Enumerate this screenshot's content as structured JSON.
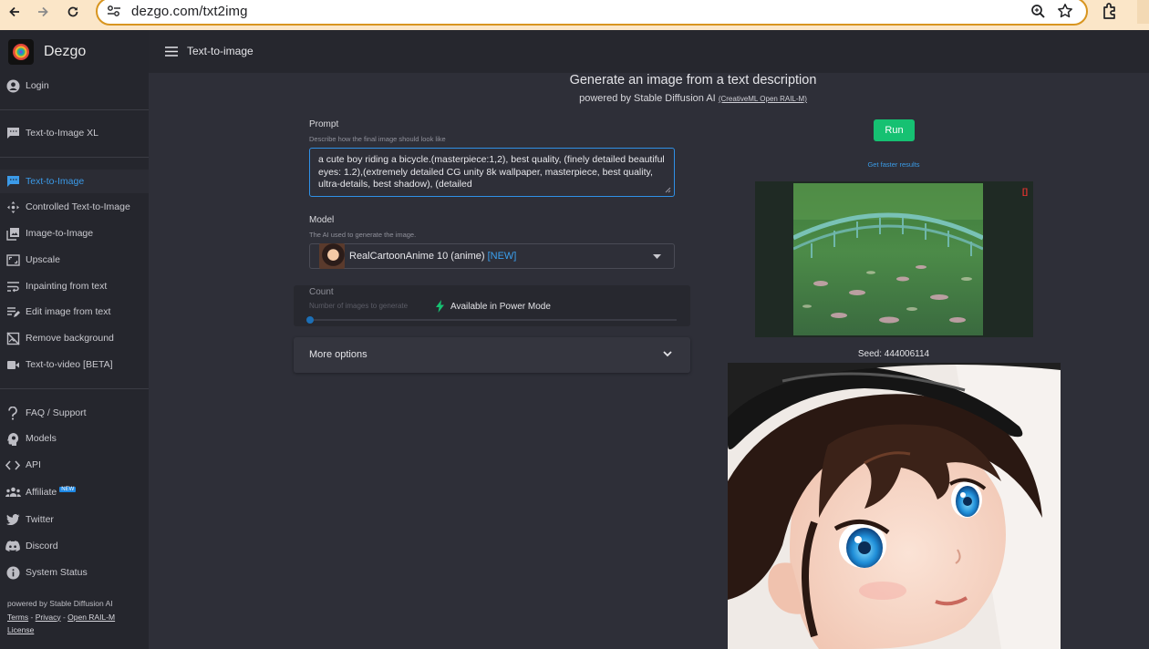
{
  "browser": {
    "url": "dezgo.com/txt2img"
  },
  "sidebar": {
    "brand": "Dezgo",
    "login": "Login",
    "items": [
      {
        "label": "Text-to-Image XL"
      },
      {
        "label": "Text-to-Image",
        "active": true
      },
      {
        "label": "Controlled Text-to-Image"
      },
      {
        "label": "Image-to-Image"
      },
      {
        "label": "Upscale"
      },
      {
        "label": "Inpainting from text"
      },
      {
        "label": "Edit image from text"
      },
      {
        "label": "Remove background"
      },
      {
        "label": "Text-to-video [BETA]"
      }
    ],
    "links": [
      {
        "label": "FAQ / Support"
      },
      {
        "label": "Models"
      },
      {
        "label": "API"
      },
      {
        "label": "Affiliate",
        "badge": "NEW"
      },
      {
        "label": "Twitter"
      },
      {
        "label": "Discord"
      },
      {
        "label": "System Status"
      }
    ],
    "footer": {
      "powered": "powered by Stable Diffusion AI",
      "terms": "Terms",
      "privacy": "Privacy",
      "rail": "Open RAIL-M",
      "license": "License",
      "sep": " - "
    }
  },
  "topbar": {
    "title": "Text-to-image"
  },
  "main": {
    "title": "Generate an image from a text description",
    "subtitle": "powered by Stable Diffusion AI",
    "license_link": "(CreativeML Open RAIL-M)",
    "prompt": {
      "label": "Prompt",
      "help": "Describe how the final image should look like",
      "value": "a cute boy riding a bicycle.(masterpiece:1,2), best quality, (finely detailed beautiful eyes: 1.2),(extremely detailed CG unity 8k wallpaper, masterpiece, best quality, ultra-details, best shadow), (detailed"
    },
    "model": {
      "label": "Model",
      "help": "The AI used to generate the image.",
      "selected": "RealCartoonAnime 10 (anime)",
      "selected_tag": "[NEW]"
    },
    "count": {
      "label": "Count",
      "help": "Number of images to generate",
      "power_mode": "Available in Power Mode"
    },
    "more_options": "More options"
  },
  "right": {
    "run_label": "Run",
    "faster_link": "Get faster results",
    "preview_corner": "[]",
    "seed_text": "Seed: 444006114"
  },
  "colors": {
    "accent_blue": "#2f90e6",
    "run_green": "#16c172",
    "sidebar_bg": "#25262d",
    "main_bg": "#2e2f38"
  }
}
